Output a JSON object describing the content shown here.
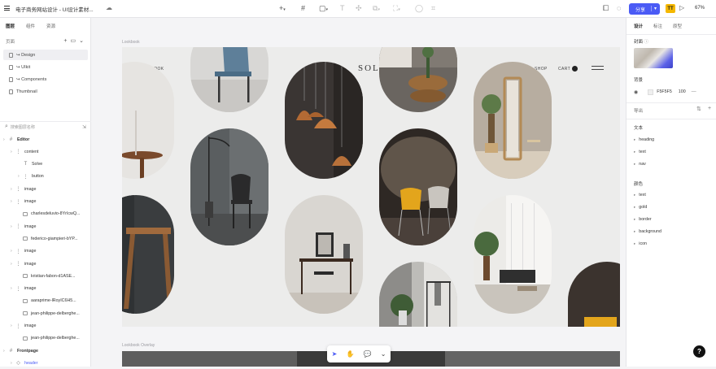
{
  "topbar": {
    "title": "电子商务网站设计 - UI设计素材...",
    "share_label": "分享",
    "share_caret": "▾",
    "user_badge": "TT",
    "zoom": "67%"
  },
  "left_panel": {
    "tabs": [
      "图层",
      "组件",
      "资源"
    ],
    "pages_heading": "页面",
    "pages": [
      "↪ Design",
      "↪ UIkit",
      "↪ Components",
      "Thumbnail"
    ],
    "search_placeholder": "搜索图层名称",
    "layers": [
      {
        "label": "Editor",
        "indent": 0,
        "icon": "frame"
      },
      {
        "label": "content",
        "indent": 1,
        "icon": "group"
      },
      {
        "label": "Solve",
        "indent": 2,
        "icon": "text"
      },
      {
        "label": "button",
        "indent": 2,
        "icon": "group"
      },
      {
        "label": "image",
        "indent": 1,
        "icon": "group"
      },
      {
        "label": "image",
        "indent": 1,
        "icon": "group"
      },
      {
        "label": "charlesdeluvio-8YrIcwQ...",
        "indent": 2,
        "icon": "image"
      },
      {
        "label": "image",
        "indent": 1,
        "icon": "group"
      },
      {
        "label": "federico-giampieri-bYP...",
        "indent": 2,
        "icon": "image"
      },
      {
        "label": "image",
        "indent": 1,
        "icon": "group"
      },
      {
        "label": "image",
        "indent": 1,
        "icon": "group"
      },
      {
        "label": "kristian-fabon-d1ASE...",
        "indent": 2,
        "icon": "image"
      },
      {
        "label": "image",
        "indent": 1,
        "icon": "group"
      },
      {
        "label": "aaraprime-lRoyIC6H5...",
        "indent": 2,
        "icon": "image"
      },
      {
        "label": "jean-philippe-delberghe...",
        "indent": 2,
        "icon": "image"
      },
      {
        "label": "image",
        "indent": 1,
        "icon": "group"
      },
      {
        "label": "jean-philippe-delberghe...",
        "indent": 2,
        "icon": "image"
      },
      {
        "label": "Frontpage",
        "indent": 0,
        "icon": "frame"
      },
      {
        "label": "header",
        "indent": 1,
        "icon": "component",
        "selected": true
      }
    ]
  },
  "canvas": {
    "frame_label": "Lookbook",
    "frame2_label": "Lookbook Overlay",
    "nav_left": "LOOKBOOK",
    "brand": "SOLVE",
    "nav_shop": "SHOP",
    "nav_cart": "CART"
  },
  "right_panel": {
    "tabs": [
      "设计",
      "标注",
      "原型"
    ],
    "cover_label": "封面",
    "background_label": "背景",
    "background_hex": "F5F5F5",
    "background_opacity": "100",
    "export_label": "导出",
    "text_styles_label": "文本",
    "text_styles": [
      "heading",
      "text",
      "nav"
    ],
    "colors_label": "颜色",
    "colors": [
      "text",
      "gold",
      "border",
      "background",
      "icon"
    ]
  },
  "help_label": "?"
}
